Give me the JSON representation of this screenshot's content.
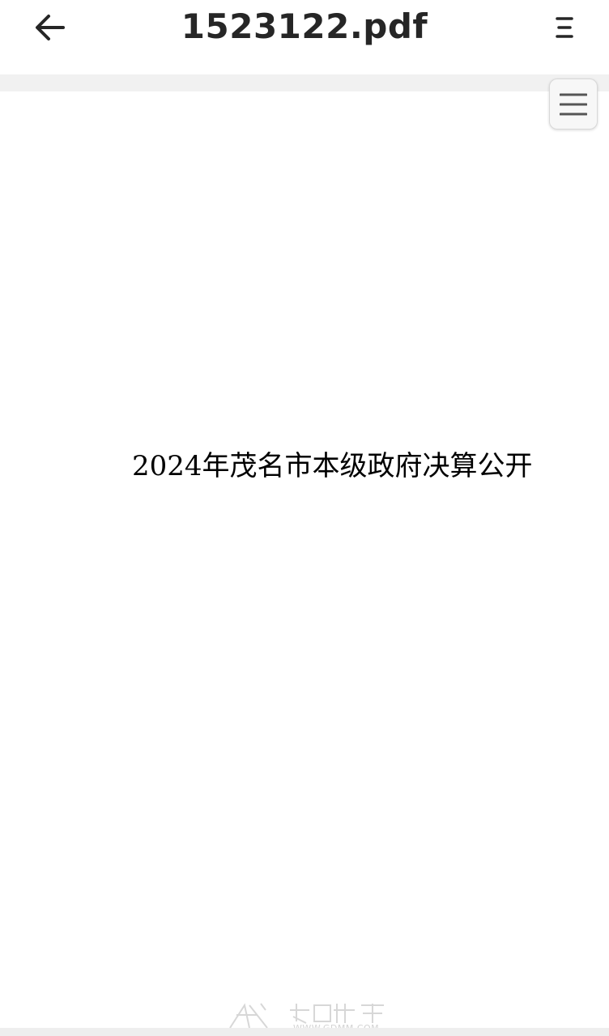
{
  "header": {
    "title": "1523122.pdf",
    "back_icon": "arrow-left-icon",
    "menu_icon": "vertical-lines-menu-icon"
  },
  "document": {
    "page_title": "2024年茂名市本级政府决算公开"
  },
  "toolbar": {
    "toc_icon": "hamburger-menu-icon"
  },
  "watermark": {
    "url_text": "WWW.GDMM.COM"
  },
  "colors": {
    "title_text": "#262626",
    "gap_gray": "#f1f1f1",
    "page_text": "#000000"
  }
}
